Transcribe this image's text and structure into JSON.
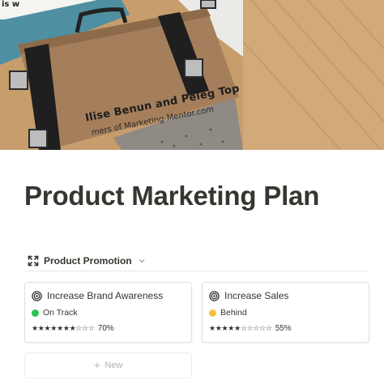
{
  "cover": {
    "banner_text": "is w",
    "book_title": "Ilise Benun and Peleg Top",
    "book_subtitle": "mers of Marketing-Mentor.com"
  },
  "page": {
    "title": "Product Marketing Plan"
  },
  "view": {
    "label": "Product Promotion",
    "icon": "expand-arrows-icon",
    "dropdown_icon": "chevron-down-icon"
  },
  "cards": [
    {
      "title": "Increase Brand Awareness",
      "icon": "target-icon",
      "status": "On Track",
      "status_color": "#2ac44f",
      "stars": "★★★★★★★☆☆☆",
      "progress_text": "70%",
      "progress": 0.7
    },
    {
      "title": "Increase Sales",
      "icon": "target-icon",
      "status": "Behind",
      "status_color": "#f5c33b",
      "stars": "★★★★★☆☆☆☆☆",
      "progress_text": "55%",
      "progress": 0.55
    }
  ],
  "new_button": {
    "label": "New"
  }
}
